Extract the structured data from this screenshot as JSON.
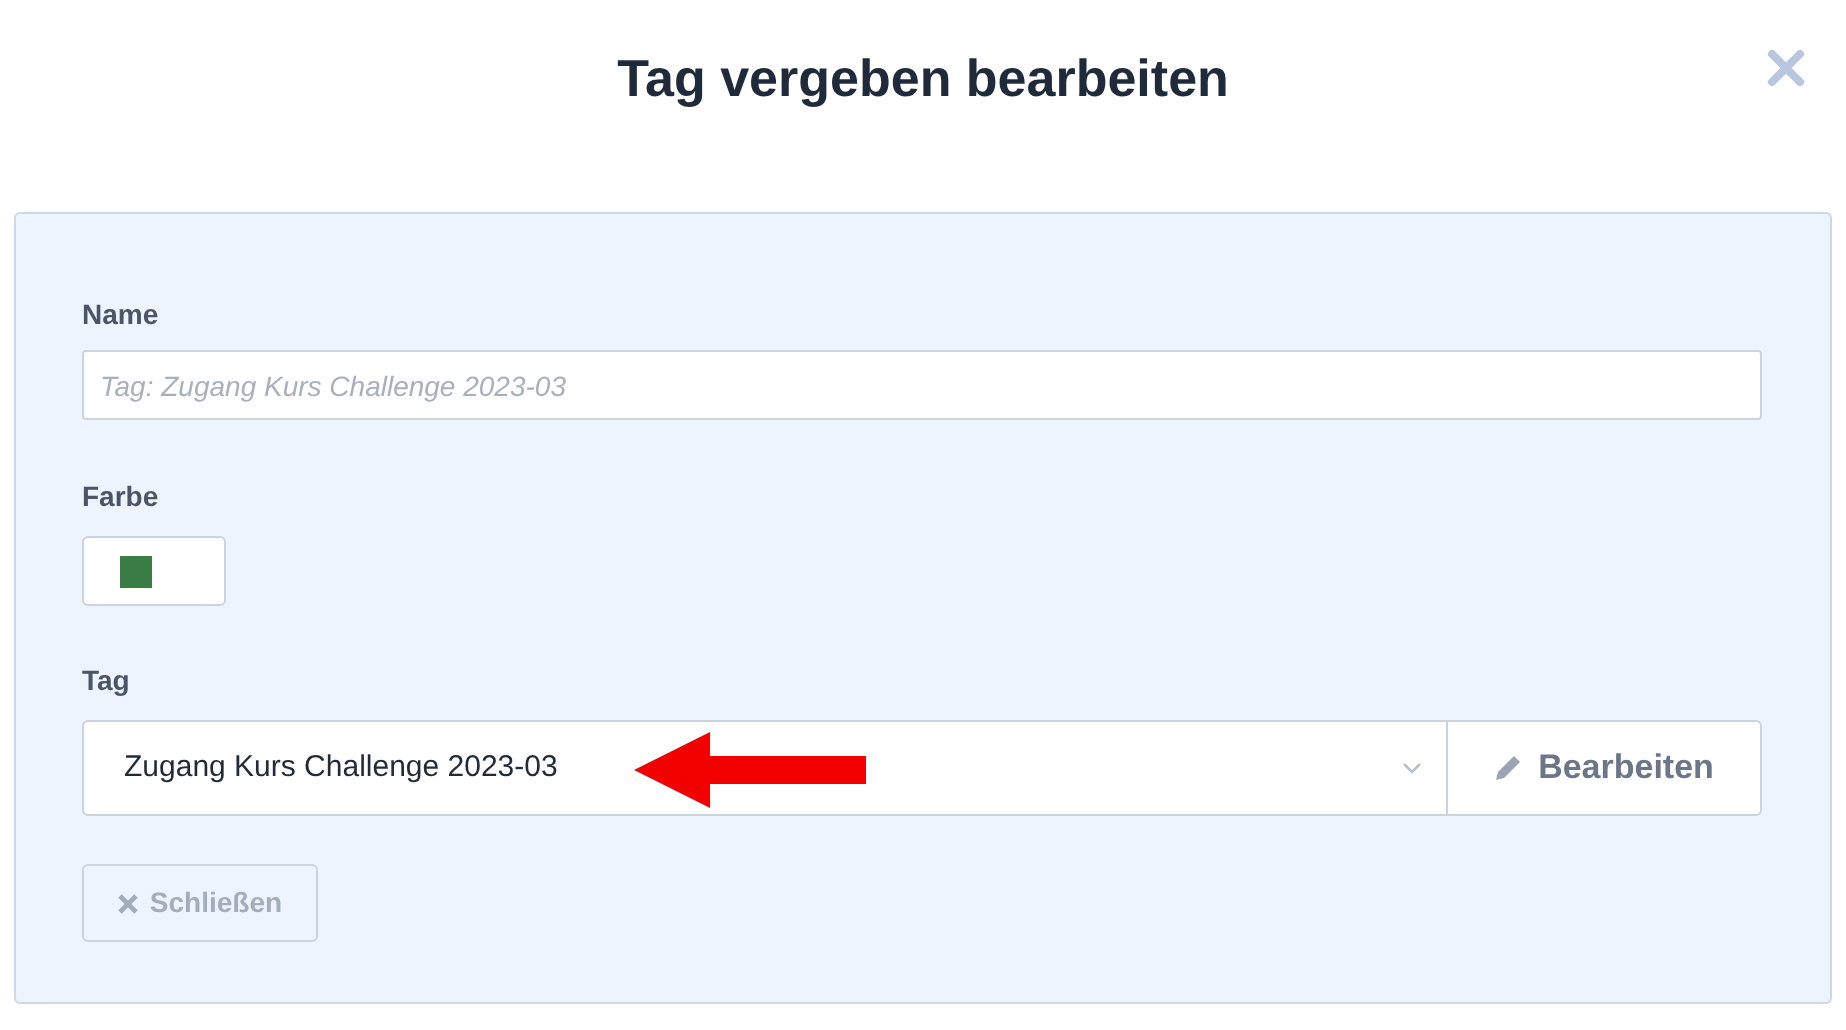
{
  "dialog": {
    "title": "Tag vergeben bearbeiten"
  },
  "name_field": {
    "label": "Name",
    "placeholder": "Tag: Zugang Kurs Challenge 2023-03"
  },
  "color_field": {
    "label": "Farbe",
    "color": "#3a7d44"
  },
  "tag_field": {
    "label": "Tag",
    "value": "Zugang Kurs Challenge 2023-03",
    "edit_button": "Bearbeiten"
  },
  "close_button": {
    "label": "Schließen",
    "disabled": true
  }
}
